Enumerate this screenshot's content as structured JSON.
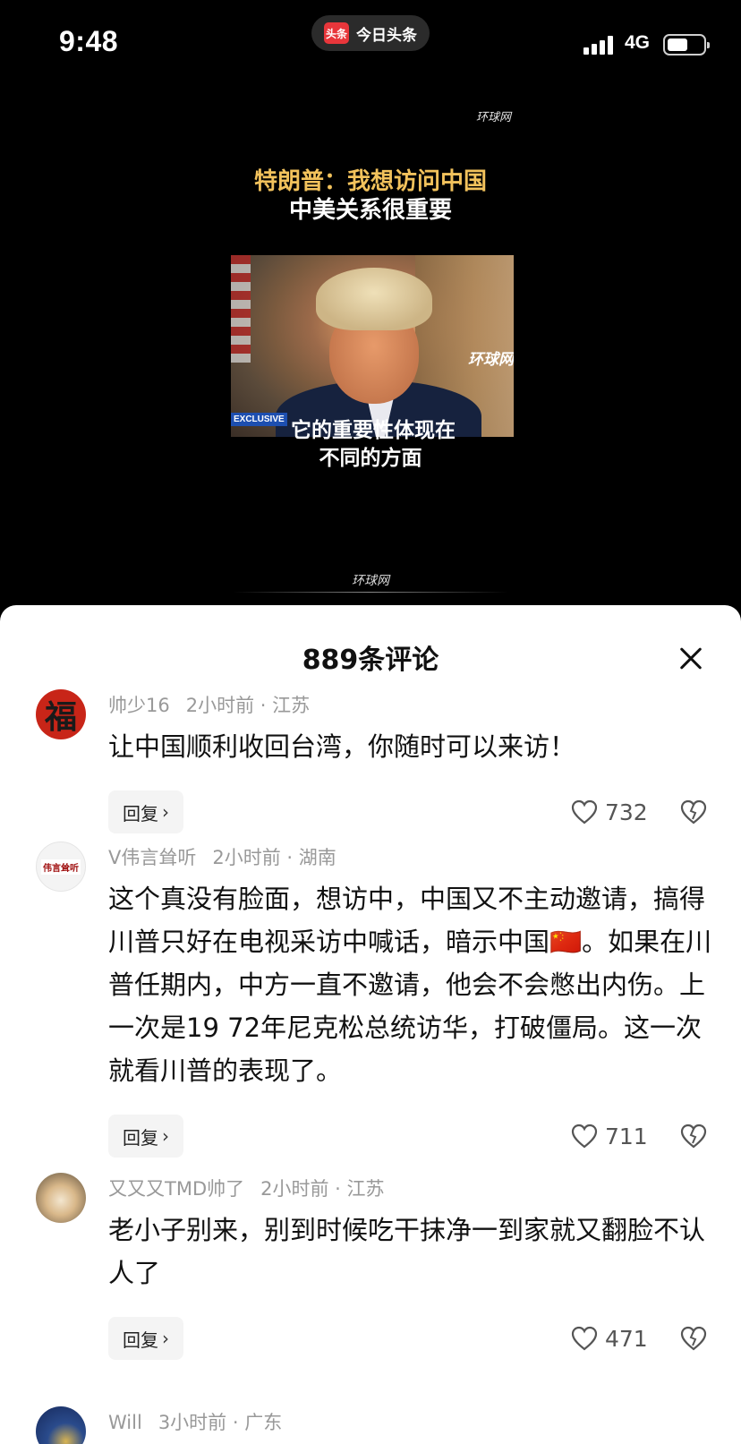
{
  "status_bar": {
    "time": "9:48",
    "app_logo_text": "头条",
    "app_name": "今日头条",
    "network": "4G"
  },
  "video": {
    "watermark_top": "环球网",
    "headline_line1": "特朗普：我想访问中国",
    "headline_line2": "中美关系很重要",
    "frame_watermark": "环球网",
    "exclusive_tag": "EXCLUSIVE",
    "subtitle_line1": "它的重要性体现在",
    "subtitle_line2": "不同的方面",
    "watermark_bottom": "环球网"
  },
  "comments_panel": {
    "title": "889条评论",
    "reply_label": "回复",
    "comments": [
      {
        "avatar_text": "福",
        "user": "帅少16",
        "time": "2小时前",
        "location": "江苏",
        "text": "让中国顺利收回台湾，你随时可以来访！",
        "likes": "732"
      },
      {
        "avatar_text": "伟言耸听",
        "user": "V伟言耸听",
        "time": "2小时前",
        "location": "湖南",
        "text": "这个真没有脸面，想访中，中国又不主动邀请，搞得川普只好在电视采访中喊话，暗示中国🇨🇳。如果在川普任期内，中方一直不邀请，他会不会憋出内伤。上一次是19 72年尼克松总统访华，打破僵局。这一次就看川普的表现了。",
        "likes": "711"
      },
      {
        "user": "又又又TMD帅了",
        "time": "2小时前",
        "location": "江苏",
        "text": "老小子别来，别到时候吃干抹净一到家就又翻脸不认人了",
        "likes": "471"
      },
      {
        "user": "Will",
        "time": "3小时前",
        "location": "广东"
      }
    ]
  },
  "colors": {
    "headline_accent": "#f2c25c",
    "sheet_background": "#ffffff",
    "meta_gray": "#999999"
  }
}
